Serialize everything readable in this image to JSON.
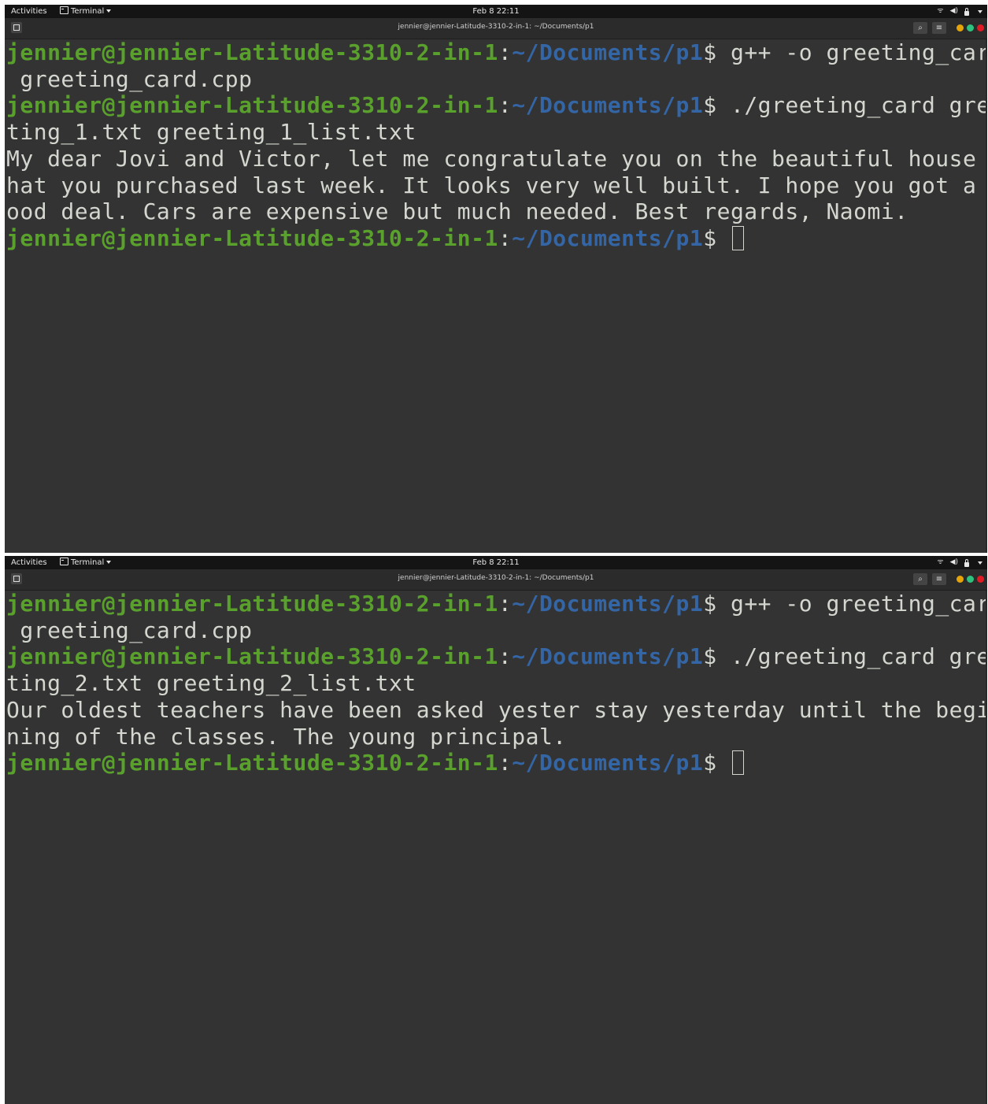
{
  "colors": {
    "prompt_user": "#5aa02c",
    "prompt_path": "#3465a4",
    "terminal_bg": "#333333",
    "terminal_text": "#d3d7cf",
    "topbar_bg": "#141414",
    "dot_minimize": "#e5a50a",
    "dot_maximize": "#2ec27e",
    "dot_close": "#e01b24"
  },
  "screens": [
    {
      "topbar": {
        "activities": "Activities",
        "app_name": "Terminal",
        "clock": "Feb 8  22:11",
        "tray_icons": [
          "wifi-icon",
          "volume-icon",
          "lock-icon",
          "chevron-down-icon"
        ]
      },
      "window_title": "jennier@jennier-Latitude-3310-2-in-1: ~/Documents/p1",
      "prompt": {
        "user": "jennier@jennier-Latitude-3310-2-in-1",
        "colon": ":",
        "path": "~/Documents/p1",
        "dollar": "$"
      },
      "commands": [
        {
          "cmd_line1": " g++ -o greeting_card",
          "cmd_line2": " greeting_card.cpp"
        },
        {
          "cmd_line1": " ./greeting_card gree",
          "cmd_line2": "ting_1.txt greeting_1_list.txt"
        }
      ],
      "output": [
        "My dear Jovi and Victor, let me congratulate you on the beautiful house t",
        "hat you purchased last week. It looks very well built. I hope you got a g",
        "ood deal. Cars are expensive but much needed. Best regards, Naomi."
      ]
    },
    {
      "topbar": {
        "activities": "Activities",
        "app_name": "Terminal",
        "clock": "Feb 8  22:11",
        "tray_icons": [
          "wifi-icon",
          "volume-icon",
          "lock-icon",
          "chevron-down-icon"
        ]
      },
      "window_title": "jennier@jennier-Latitude-3310-2-in-1: ~/Documents/p1",
      "prompt": {
        "user": "jennier@jennier-Latitude-3310-2-in-1",
        "colon": ":",
        "path": "~/Documents/p1",
        "dollar": "$"
      },
      "commands": [
        {
          "cmd_line1": " g++ -o greeting_card",
          "cmd_line2": " greeting_card.cpp"
        },
        {
          "cmd_line1": " ./greeting_card gree",
          "cmd_line2": "ting_2.txt greeting_2_list.txt"
        }
      ],
      "output": [
        "Our oldest teachers have been asked yester stay yesterday until the begin",
        "ning of the classes. The young principal."
      ]
    }
  ]
}
